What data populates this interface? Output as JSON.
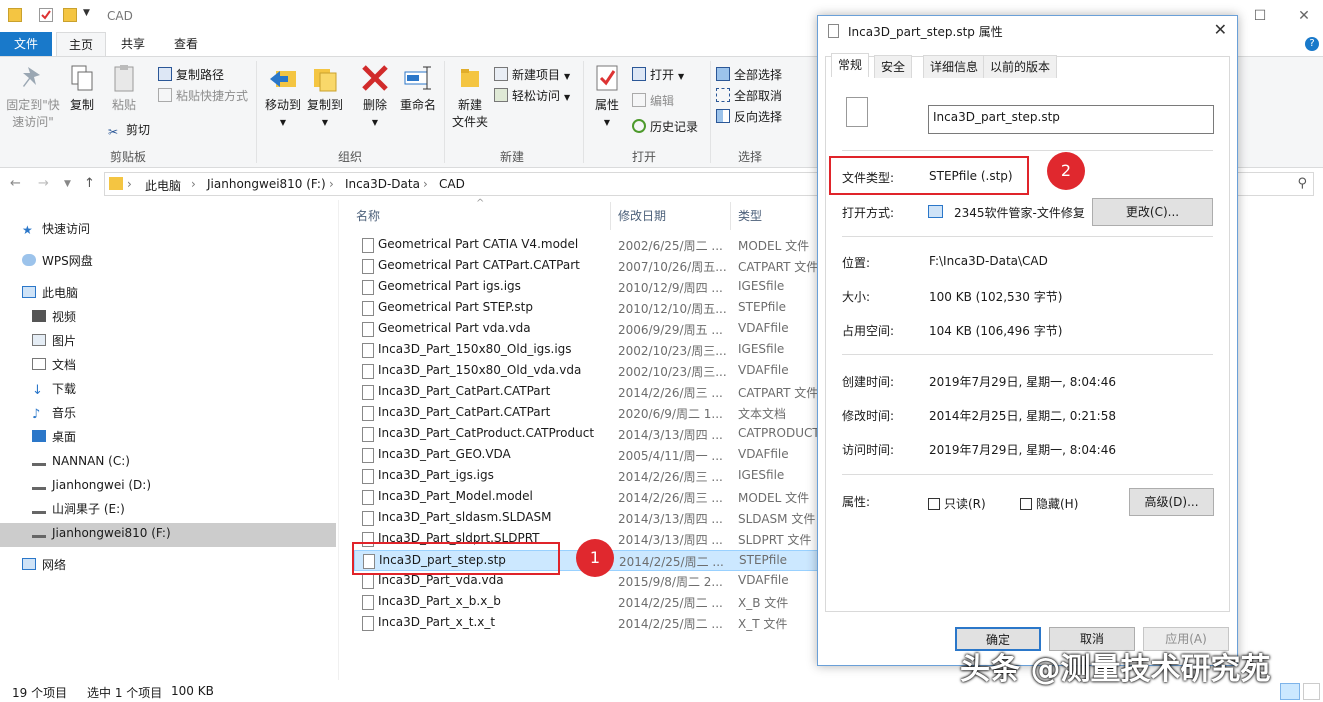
{
  "window": {
    "title": "CAD"
  },
  "ribbon_tabs": [
    "文件",
    "主页",
    "共享",
    "查看"
  ],
  "ribbon": {
    "clipboard": {
      "pin_label_1": "固定到\"快",
      "pin_label_2": "速访问\"",
      "copy": "复制",
      "paste": "粘贴",
      "copy_path": "复制路径",
      "paste_shortcut": "粘贴快捷方式",
      "cut": "剪切",
      "group": "剪贴板"
    },
    "organize": {
      "move_to": "移动到",
      "copy_to": "复制到",
      "delete": "删除",
      "rename": "重命名",
      "group": "组织"
    },
    "new": {
      "new_folder_1": "新建",
      "new_folder_2": "文件夹",
      "new_item": "新建项目",
      "easy_access": "轻松访问",
      "group": "新建"
    },
    "open": {
      "properties": "属性",
      "open": "打开",
      "edit": "编辑",
      "history": "历史记录",
      "group": "打开"
    },
    "select": {
      "select_all": "全部选择",
      "select_none": "全部取消",
      "invert": "反向选择",
      "group": "选择"
    }
  },
  "address": {
    "crumbs": [
      "此电脑",
      "Jianhongwei810 (F:)",
      "Inca3D-Data",
      "CAD"
    ]
  },
  "nav": {
    "quick_access": "快速访问",
    "wps": "WPS网盘",
    "this_pc": "此电脑",
    "video": "视频",
    "pictures": "图片",
    "documents": "文档",
    "downloads": "下载",
    "music": "音乐",
    "desktop": "桌面",
    "drive_c": "NANNAN (C:)",
    "drive_d": "Jianhongwei (D:)",
    "drive_e": "山涧果子 (E:)",
    "drive_f": "Jianhongwei810 (F:)",
    "network": "网络"
  },
  "list": {
    "columns": {
      "name": "名称",
      "date": "修改日期",
      "type": "类型"
    },
    "files": [
      {
        "name": "Geometrical Part CATIA V4.model",
        "date": "2002/6/25/周二 ...",
        "type": "MODEL 文件"
      },
      {
        "name": "Geometrical Part CATPart.CATPart",
        "date": "2007/10/26/周五...",
        "type": "CATPART 文件"
      },
      {
        "name": "Geometrical Part igs.igs",
        "date": "2010/12/9/周四 ...",
        "type": "IGESfile"
      },
      {
        "name": "Geometrical Part STEP.stp",
        "date": "2010/12/10/周五...",
        "type": "STEPfile"
      },
      {
        "name": "Geometrical Part vda.vda",
        "date": "2006/9/29/周五 ...",
        "type": "VDAFfile"
      },
      {
        "name": "Inca3D_Part_150x80_Old_igs.igs",
        "date": "2002/10/23/周三...",
        "type": "IGESfile"
      },
      {
        "name": "Inca3D_Part_150x80_Old_vda.vda",
        "date": "2002/10/23/周三...",
        "type": "VDAFfile"
      },
      {
        "name": "Inca3D_Part_CatPart.CATPart",
        "date": "2014/2/26/周三 ...",
        "type": "CATPART 文件"
      },
      {
        "name": "Inca3D_Part_CatPart.CATPart",
        "date": "2020/6/9/周二 1...",
        "type": "文本文档"
      },
      {
        "name": "Inca3D_Part_CatProduct.CATProduct",
        "date": "2014/3/13/周四 ...",
        "type": "CATPRODUCT"
      },
      {
        "name": "Inca3D_Part_GEO.VDA",
        "date": "2005/4/11/周一 ...",
        "type": "VDAFfile"
      },
      {
        "name": "Inca3D_Part_igs.igs",
        "date": "2014/2/26/周三 ...",
        "type": "IGESfile"
      },
      {
        "name": "Inca3D_Part_Model.model",
        "date": "2014/2/26/周三 ...",
        "type": "MODEL 文件"
      },
      {
        "name": "Inca3D_Part_sldasm.SLDASM",
        "date": "2014/3/13/周四 ...",
        "type": "SLDASM 文件"
      },
      {
        "name": "Inca3D_Part_sldprt.SLDPRT",
        "date": "2014/3/13/周四 ...",
        "type": "SLDPRT 文件"
      },
      {
        "name": "Inca3D_part_step.stp",
        "date": "2014/2/25/周二 ...",
        "type": "STEPfile"
      },
      {
        "name": "Inca3D_Part_vda.vda",
        "date": "2015/9/8/周二 2...",
        "type": "VDAFfile"
      },
      {
        "name": "Inca3D_Part_x_b.x_b",
        "date": "2014/2/25/周二 ...",
        "type": "X_B 文件"
      },
      {
        "name": "Inca3D_Part_x_t.x_t",
        "date": "2014/2/25/周二 ...",
        "type": "X_T 文件"
      }
    ]
  },
  "status": {
    "count": "19 个项目",
    "selected": "选中 1 个项目",
    "size": "100 KB"
  },
  "dialog": {
    "title": "Inca3D_part_step.stp 属性",
    "tabs": [
      "常规",
      "安全",
      "详细信息",
      "以前的版本"
    ],
    "filename": "Inca3D_part_step.stp",
    "type_label": "文件类型:",
    "type_value": "STEPfile (.stp)",
    "opens_label": "打开方式:",
    "opens_value": "2345软件管家-文件修复",
    "change_btn": "更改(C)...",
    "location_label": "位置:",
    "location_value": "F:\\Inca3D-Data\\CAD",
    "size_label": "大小:",
    "size_value": "100 KB (102,530 字节)",
    "disk_label": "占用空间:",
    "disk_value": "104 KB (106,496 字节)",
    "created_label": "创建时间:",
    "created_value": "2019年7月29日, 星期一, 8:04:46",
    "modified_label": "修改时间:",
    "modified_value": "2014年2月25日, 星期二, 0:21:58",
    "accessed_label": "访问时间:",
    "accessed_value": "2019年7月29日, 星期一, 8:04:46",
    "attr_label": "属性:",
    "readonly": "只读(R)",
    "hidden": "隐藏(H)",
    "advanced_btn": "高级(D)...",
    "ok": "确定",
    "cancel": "取消",
    "apply": "应用(A)"
  },
  "annotations": {
    "badge1": "1",
    "badge2": "2"
  },
  "watermark": "头条 @测量技术研究苑",
  "colors": {
    "accent": "#1979ca",
    "selection": "#cce8ff",
    "annotation_red": "#e0242a"
  }
}
